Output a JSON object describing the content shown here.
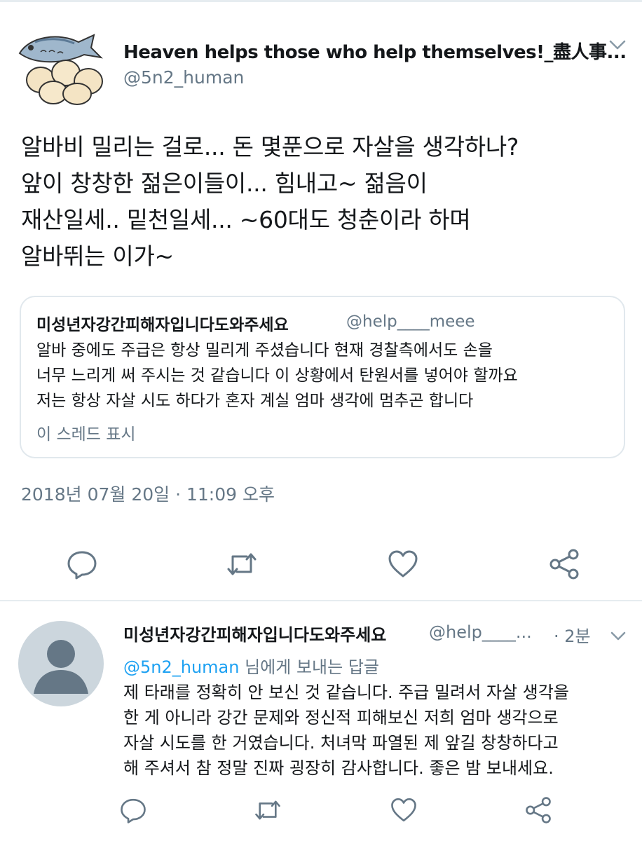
{
  "tweet": {
    "author_name": "Heaven helps those who help themselves!_盡人事...",
    "author_handle": "@5n2_human",
    "text_lines": [
      "알바비 밀리는 걸로... 돈 몇푼으로 자살을 생각하나?",
      "앞이 창창한 젊은이들이... 힘내고~ 젊음이",
      "재산일세.. 밑천일세... ~60대도 청춘이라 하며",
      "알바뛰는 이가~"
    ],
    "timestamp": "2018년 07월 20일 · 11:09 오후",
    "icons": [
      "reply-icon",
      "retweet-icon",
      "like-icon",
      "share-icon"
    ]
  },
  "quoted": {
    "author_name": "미성년자강간피해자입니다도와주세요",
    "author_handle": "@help____meee",
    "text_lines": [
      "알바 중에도 주급은 항상 밀리게 주셨습니다 현재 경찰측에서도 손을",
      "너무 느리게 써 주시는 것 같습니다 이 상황에서 탄원서를 넣어야 할까요",
      "저는 항상 자살 시도 하다가 혼자 계실 엄마 생각에 멈추곤 합니다"
    ],
    "show_thread": "이 스레드 표시"
  },
  "reply": {
    "author_name": "미성년자강간피해자입니다도와주세요",
    "author_handle": "@help____...",
    "time": "· 2분",
    "reply_to_handle": "@5n2_human",
    "reply_to_suffix": " 님에게 보내는 답글",
    "text_lines": [
      "제 타래를 정확히 안 보신 것 같습니다. 주급 밀려서 자살 생각을",
      "한 게 아니라 강간 문제와 정신적 피해보신 저희 엄마 생각으로",
      "자살 시도를 한 거였습니다. 처녀막 파열된 제 앞길 창창하다고",
      "해 주셔서 참 정말 진짜 굉장히 감사합니다. 좋은 밤 보내세요."
    ]
  },
  "colors": {
    "secondary_text": "#657786",
    "link": "#1da1f2",
    "divider": "#e6ecf0",
    "avatar_placeholder": "#ccd6dd"
  }
}
